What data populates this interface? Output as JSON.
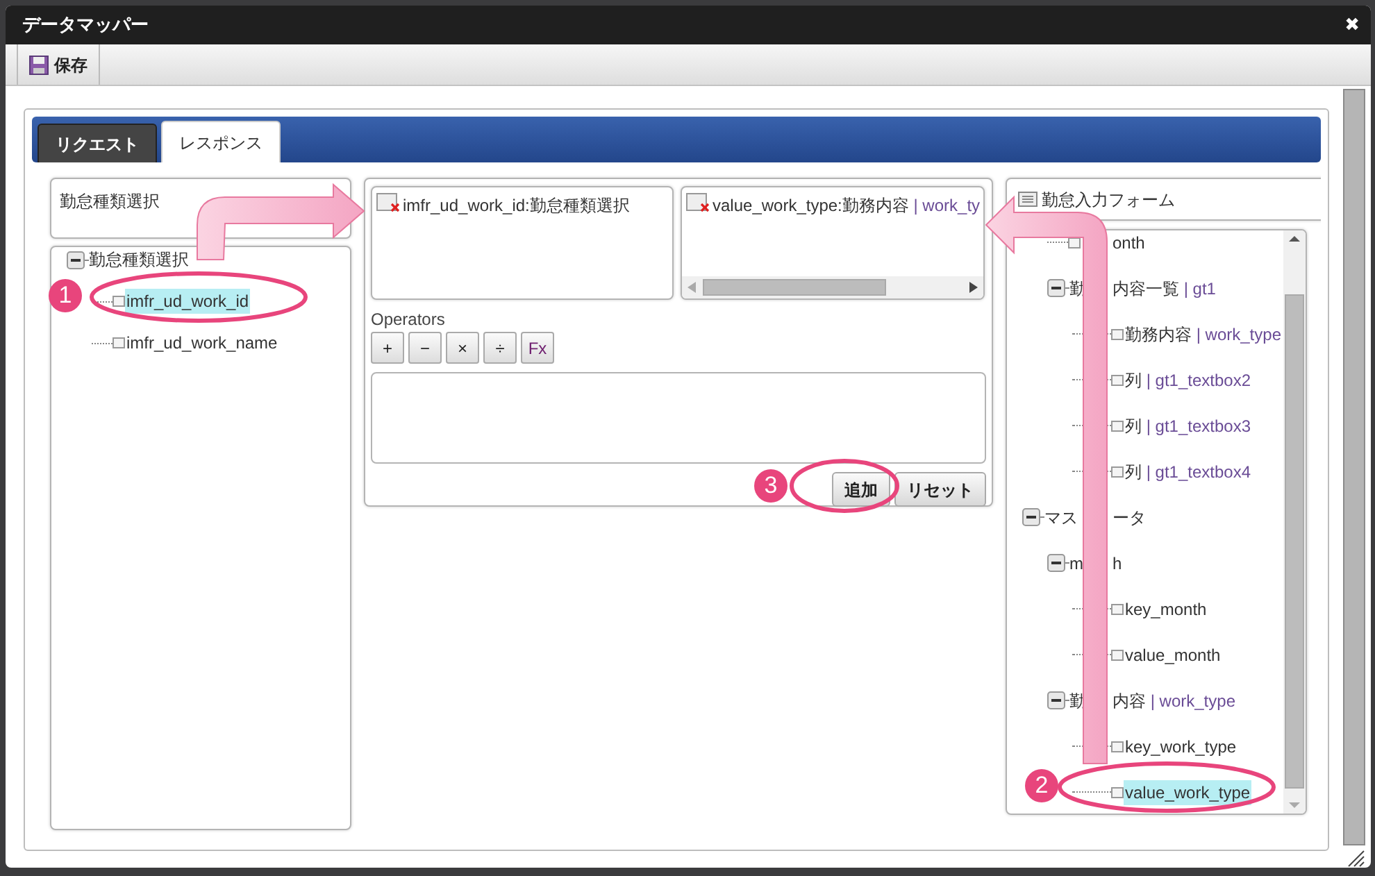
{
  "window": {
    "title": "データマッパー",
    "close": "✖"
  },
  "toolbar": {
    "save": "保存"
  },
  "tabs": [
    {
      "label": "リクエスト",
      "selected": false
    },
    {
      "label": "レスポンス",
      "selected": true
    }
  ],
  "source_panel": {
    "title": "勤怠種類選択",
    "tree": [
      {
        "segments": [
          {
            "text": "勤怠種類選択",
            "kind": "name"
          }
        ],
        "expanded": true,
        "children": [
          {
            "segments": [
              {
                "text": "imfr_ud_work_id",
                "kind": "name"
              }
            ],
            "selected": true
          },
          {
            "segments": [
              {
                "text": "imfr_ud_work_name",
                "kind": "name"
              }
            ],
            "selected": false
          }
        ]
      }
    ]
  },
  "mapping": {
    "source_item": [
      {
        "text": "imfr_ud_work_id:勤怠種類選択",
        "kind": "name"
      }
    ],
    "target_item": [
      {
        "text": "value_work_type:勤務内容 ",
        "kind": "name"
      },
      {
        "text": "| work_ty",
        "kind": "id"
      }
    ],
    "operators_label": "Operators",
    "operators": [
      "+",
      "−",
      "×",
      "÷",
      "Fx"
    ],
    "buttons": [
      "追加",
      "リセット"
    ]
  },
  "target_panel": {
    "title": "勤怠入力フォーム",
    "upper_items": [
      {
        "segments": [
          {
            "kind": "gap"
          },
          {
            "text": "onth",
            "kind": "name"
          }
        ],
        "selected": false
      },
      {
        "segments": [
          {
            "text": "勤",
            "kind": "name"
          },
          {
            "kind": "gap"
          },
          {
            "text": "内容一覧 ",
            "kind": "name"
          },
          {
            "text": "| gt1",
            "kind": "id"
          }
        ],
        "expanded": true,
        "children": [
          {
            "segments": [
              {
                "text": "勤務内容 ",
                "kind": "name"
              },
              {
                "text": "| work_type",
                "kind": "id"
              }
            ],
            "selected": false
          },
          {
            "segments": [
              {
                "text": "列 ",
                "kind": "name"
              },
              {
                "text": "| gt1_textbox2",
                "kind": "id"
              }
            ],
            "selected": false
          },
          {
            "segments": [
              {
                "text": "列 ",
                "kind": "name"
              },
              {
                "text": "| gt1_textbox3",
                "kind": "id"
              }
            ],
            "selected": false
          },
          {
            "segments": [
              {
                "text": "列 ",
                "kind": "name"
              },
              {
                "text": "| gt1_textbox4",
                "kind": "id"
              }
            ],
            "selected": false
          }
        ]
      }
    ],
    "tree": [
      {
        "segments": [
          {
            "text": "マス",
            "kind": "name"
          },
          {
            "kind": "gap"
          },
          {
            "text": "ータ",
            "kind": "name"
          }
        ],
        "expanded": true,
        "children": [
          {
            "segments": [
              {
                "text": "m",
                "kind": "name"
              },
              {
                "kind": "gap"
              },
              {
                "text": "h",
                "kind": "name"
              }
            ],
            "expanded": true,
            "children": [
              {
                "segments": [
                  {
                    "text": "key_month",
                    "kind": "name"
                  }
                ],
                "selected": false
              },
              {
                "segments": [
                  {
                    "text": "value_month",
                    "kind": "name"
                  }
                ],
                "selected": false
              }
            ]
          },
          {
            "segments": [
              {
                "text": "勤",
                "kind": "name"
              },
              {
                "kind": "gap"
              },
              {
                "text": "内容 ",
                "kind": "name"
              },
              {
                "text": "| work_type",
                "kind": "id"
              }
            ],
            "expanded": true,
            "children": [
              {
                "segments": [
                  {
                    "text": "key_work_type",
                    "kind": "name"
                  }
                ],
                "selected": false
              },
              {
                "segments": [
                  {
                    "text": "value_work_type",
                    "kind": "name"
                  }
                ],
                "selected": true
              }
            ]
          }
        ]
      }
    ]
  },
  "annotations": [
    {
      "number": "1"
    },
    {
      "number": "2"
    },
    {
      "number": "3"
    }
  ]
}
